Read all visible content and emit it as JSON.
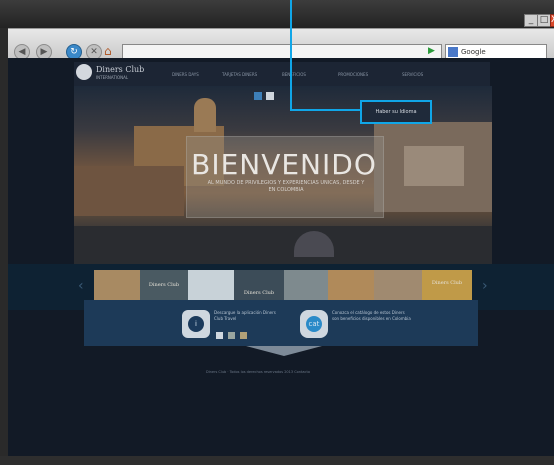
{
  "browser": {
    "window_buttons": {
      "minimize": "_",
      "maximize": "□",
      "close": "X"
    },
    "search_placeholder": "Google"
  },
  "site": {
    "logo_line1": "Diners Club",
    "logo_line2": "INTERNATIONAL",
    "nav": [
      "DINERS DAYS",
      "TARJETAS DINERS",
      "BENEFICIOS",
      "PROMOCIONES",
      "SERVICIOS"
    ],
    "language_button": "Haber su Idioma",
    "hero_title": "BIENVENIDO",
    "hero_subtitle": "AL MUNDO DE PRIVILEGIOS Y EXPERIENCIAS UNICAS, DESDE Y EN COLOMBIA",
    "slide_label_1": "Diners Club",
    "slide_label_2": "Diners Club",
    "slide_label_3": "Diners Club",
    "info_1_text": "Descargue la aplicación Diners Club Travel",
    "info_2_text": "Conozca el catálogo de estos Diners son beneficios disponibles en Colombia",
    "footer": "Diners Club · Todos los derechos reservados 2013          Contacto"
  },
  "colors": {
    "accent": "#10a6e8",
    "page_bg": "#121a26",
    "panel": "#1d3a58"
  }
}
